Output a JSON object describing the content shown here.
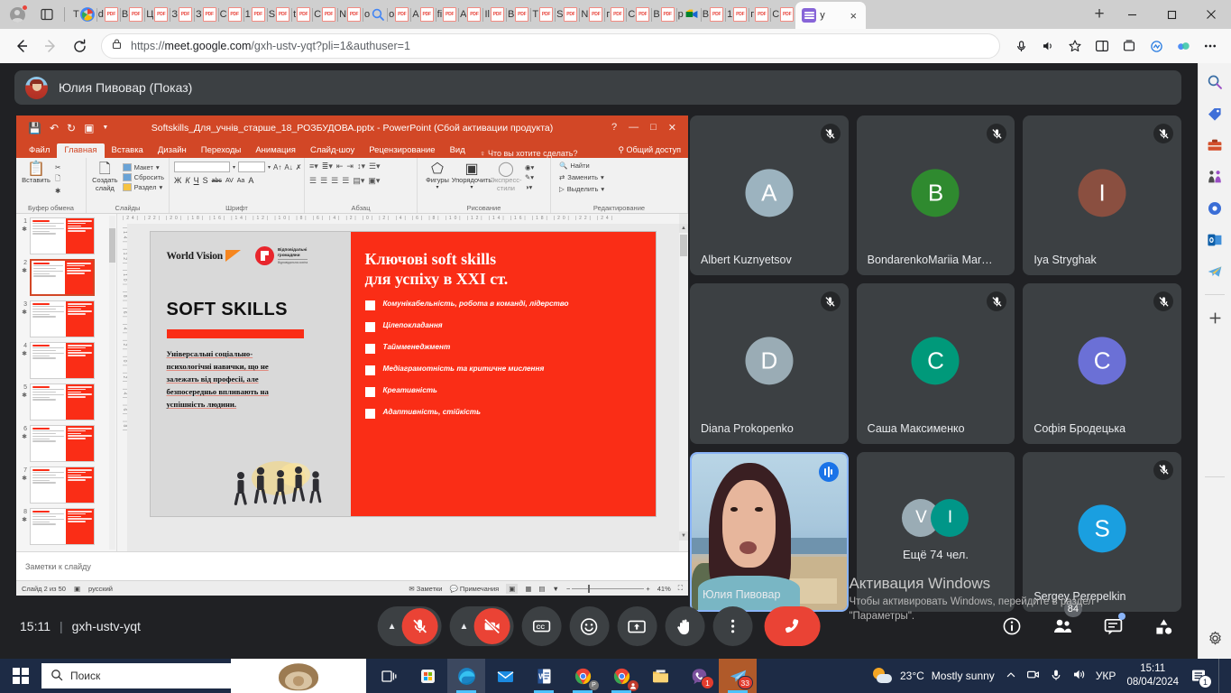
{
  "browser": {
    "name": "Microsoft Edge",
    "profile_icon": "profile-avatar-icon",
    "tab_search_icon": "tab-search-icon",
    "tabs": [
      {
        "title": "T",
        "icon": "google-icon"
      },
      {
        "title": "d",
        "icon": "pdf-icon"
      },
      {
        "title": "B",
        "icon": "pdf-icon"
      },
      {
        "title": "Ц",
        "icon": "pdf-icon"
      },
      {
        "title": "З",
        "icon": "pdf-icon"
      },
      {
        "title": "З",
        "icon": "pdf-icon"
      },
      {
        "title": "С",
        "icon": "pdf-icon"
      },
      {
        "title": "1",
        "icon": "pdf-icon"
      },
      {
        "title": "S",
        "icon": "pdf-icon"
      },
      {
        "title": "t",
        "icon": "pdf-icon"
      },
      {
        "title": "С",
        "icon": "pdf-icon"
      },
      {
        "title": "N",
        "icon": "pdf-icon"
      },
      {
        "title": "o",
        "icon": "search-icon"
      },
      {
        "title": "o",
        "icon": "pdf-icon"
      },
      {
        "title": "A",
        "icon": "pdf-icon"
      },
      {
        "title": "fi",
        "icon": "pdf-icon"
      },
      {
        "title": "A",
        "icon": "pdf-icon"
      },
      {
        "title": "Il",
        "icon": "pdf-icon"
      },
      {
        "title": "B",
        "icon": "pdf-icon"
      },
      {
        "title": "T",
        "icon": "pdf-icon"
      },
      {
        "title": "S",
        "icon": "pdf-icon"
      },
      {
        "title": "N",
        "icon": "pdf-icon"
      },
      {
        "title": "г",
        "icon": "pdf-icon"
      },
      {
        "title": "С",
        "icon": "pdf-icon"
      },
      {
        "title": "В",
        "icon": "pdf-icon"
      },
      {
        "title": "p",
        "icon": "meet-icon"
      },
      {
        "title": "В",
        "icon": "pdf-icon"
      },
      {
        "title": "1",
        "icon": "pdf-icon"
      },
      {
        "title": "г",
        "icon": "pdf-icon"
      },
      {
        "title": "С",
        "icon": "pdf-icon"
      }
    ],
    "active_tab": {
      "title": "у",
      "icon": "list-icon",
      "close_label": "×"
    },
    "new_tab_label": "+",
    "window_controls": {
      "minimize": "—",
      "maximize": "⬜",
      "close": "✕"
    },
    "toolbar": {
      "back_icon": "back-arrow-icon",
      "forward_icon": "forward-arrow-icon",
      "refresh_icon": "refresh-icon",
      "lock_icon": "lock-icon",
      "url_prefix": "https://",
      "url_domain": "meet.google.com",
      "url_path": "/gxh-ustv-yqt?pli=1&authuser=1",
      "mic_icon": "microphone-icon",
      "read_aloud_icon": "read-aloud-icon",
      "favorite_icon": "star-icon",
      "split_screen_icon": "split-screen-icon",
      "collections_icon": "collections-icon",
      "browser_essentials_icon": "browser-essentials-icon",
      "copilot_icon": "copilot-icon",
      "settings_more_icon": "more-options-icon"
    },
    "sidebar_icons": [
      "search-icon",
      "shopping-tag-icon",
      "tools-icon",
      "games-icon",
      "microsoft-365-icon",
      "outlook-icon",
      "telegram-icon",
      "add-sidebar-app-icon",
      "sidebar-settings-gear-icon"
    ]
  },
  "meet": {
    "presentation_header": {
      "presenter": "Юлия Пивовар (Показ)",
      "avatar_icon": "presenter-avatar"
    },
    "powerpoint": {
      "title": "Softskills_Для_учнів_старше_18_РОЗБУДОВА.pptx - PowerPoint (Сбой активации продукта)",
      "quick_access": [
        "save-icon",
        "undo-icon",
        "redo-icon",
        "present-icon",
        "customize-qat-icon"
      ],
      "window_controls": {
        "help": "?",
        "minimize": "—",
        "restore": "⬜",
        "close": "✕"
      },
      "ribbon_tabs": [
        "Файл",
        "Главная",
        "Вставка",
        "Дизайн",
        "Переходы",
        "Анимация",
        "Слайд-шоу",
        "Рецензирование",
        "Вид"
      ],
      "active_ribbon_tab": "Главная",
      "tell_me": "Что вы хотите сделать?",
      "share_label": "Общий доступ",
      "groups": [
        {
          "label": "Буфер обмена",
          "big_button": "Вставить",
          "items": [
            "Вырезать",
            "Копировать",
            "Формат по образцу"
          ]
        },
        {
          "label": "Слайды",
          "big_button": "Создать слайд",
          "items": [
            "Макет",
            "Сбросить",
            "Раздел"
          ]
        },
        {
          "label": "Шрифт",
          "items": [
            "Ж",
            "К",
            "Ч",
            "S",
            "abc",
            "AV",
            "Aa",
            "A"
          ]
        },
        {
          "label": "Абзац",
          "items": []
        },
        {
          "label": "Рисование",
          "items": [
            "Фигуры",
            "Упорядочить",
            "Экспресс-стили"
          ]
        },
        {
          "label": "Редактирование",
          "items": [
            "Найти",
            "Заменить",
            "Выделить"
          ]
        }
      ],
      "slide": {
        "logo_world_vision": "World Vision",
        "logo_responsible_1": "Відповідальні",
        "logo_responsible_2": "громадяни",
        "logo_responsible_sub": "Відповідальна освіта",
        "heading": "SOFT SKILLS",
        "body": "Універсальні соціально-психологічні навички, що не залежать від професії, але безпосередньо впливають на успішність людини.",
        "right_title_line1": "Ключові soft skills",
        "right_title_line2": "для успіху в XXI ст.",
        "bullets": [
          "Комунікабельність, робота в команді, лідерство",
          "Цілепокладання",
          "Таймменеджмент",
          "Медіаграмотність та критичне  мислення",
          "Креативність",
          "Адаптивність, стійкість"
        ],
        "accent_color": "#fa2d16"
      },
      "thumbnails": [
        "1",
        "2",
        "3",
        "4",
        "5",
        "6",
        "7",
        "8"
      ],
      "selected_thumbnail": "2",
      "notes_placeholder": "Заметки к слайду",
      "status": {
        "slide_counter": "Слайд 2 из 50",
        "language": "русский",
        "notes_btn": "Заметки",
        "comments_btn": "Примечания",
        "zoom": "41%",
        "view_icons": [
          "normal-view-icon",
          "slide-sorter-icon",
          "reading-view-icon",
          "slideshow-icon"
        ],
        "fit_icon": "fit-to-window-icon"
      }
    },
    "participants": [
      {
        "name": "Albert Kuznyetsov",
        "initial": "A",
        "color": "#9cb3bf",
        "muted": true,
        "type": "avatar"
      },
      {
        "name": "BondarenkoMariia Mar…",
        "initial": "B",
        "color": "#2f8a2f",
        "muted": true,
        "type": "avatar"
      },
      {
        "name": "Iya Stryghak",
        "initial": "I",
        "color": "#8a4f40",
        "muted": true,
        "type": "avatar"
      },
      {
        "name": "Diana Prokopenko",
        "initial": "D",
        "color": "#9aacb5",
        "muted": true,
        "type": "avatar"
      },
      {
        "name": "Саша Максименко",
        "initial": "C",
        "color": "#00997a",
        "muted": true,
        "type": "avatar"
      },
      {
        "name": "Софія Бродецька",
        "initial": "C",
        "color": "#6b70d6",
        "muted": true,
        "type": "avatar"
      },
      {
        "name": "Юлия Пивовар",
        "initial": "",
        "color": "",
        "muted": false,
        "type": "video",
        "speaking": true
      },
      {
        "name": "Ещё 74 чел.",
        "initial": "",
        "color": "",
        "muted": false,
        "type": "overflow",
        "overflow_avatars": [
          {
            "initial": "V",
            "color": "#9aacb5"
          },
          {
            "initial": "I",
            "color": "#009688"
          }
        ]
      },
      {
        "name": "Sergey Perepelkin",
        "initial": "S",
        "color": "#1a9fe0",
        "muted": true,
        "type": "avatar"
      }
    ],
    "bottom_bar": {
      "time": "15:11",
      "separator": "|",
      "meeting_code": "gxh-ustv-yqt",
      "controls": [
        {
          "name": "microphone-toggle",
          "state": "muted",
          "icon": "mic-off-icon"
        },
        {
          "name": "camera-toggle",
          "state": "off",
          "icon": "camera-off-icon"
        },
        {
          "name": "captions-toggle",
          "icon": "cc-icon"
        },
        {
          "name": "emoji-reactions",
          "icon": "emoji-icon"
        },
        {
          "name": "present-now",
          "icon": "present-screen-icon"
        },
        {
          "name": "raise-hand",
          "icon": "hand-icon"
        },
        {
          "name": "more-options",
          "icon": "more-vertical-icon"
        },
        {
          "name": "leave-call",
          "icon": "end-call-icon"
        }
      ],
      "right_controls": [
        {
          "name": "meeting-details",
          "icon": "info-icon"
        },
        {
          "name": "show-everyone",
          "icon": "people-icon",
          "badge": "84"
        },
        {
          "name": "chat-with-everyone",
          "icon": "chat-icon",
          "has_dot": true
        },
        {
          "name": "activities",
          "icon": "activities-icon"
        }
      ]
    },
    "windows_activation": {
      "title": "Активация Windows",
      "subtitle_line1": "Чтобы активировать Windows, перейдите в раздел",
      "subtitle_line2": "\"Параметры\"."
    }
  },
  "taskbar": {
    "start_icon": "windows-start-icon",
    "search_placeholder": "Поиск",
    "search_icon": "search-icon",
    "wallpaper_icon": "hedgehog-wallpaper",
    "apps": [
      {
        "name": "task-view",
        "icon": "task-view-icon",
        "badge": null
      },
      {
        "name": "microsoft-store",
        "icon": "store-icon",
        "badge": null
      },
      {
        "name": "microsoft-edge",
        "icon": "edge-icon",
        "badge": null,
        "active": true
      },
      {
        "name": "mail",
        "icon": "mail-icon",
        "badge": null
      },
      {
        "name": "word",
        "icon": "word-icon",
        "badge": null,
        "open": true
      },
      {
        "name": "chrome-profile-p",
        "icon": "chrome-icon",
        "badge": null,
        "open": true
      },
      {
        "name": "chrome-profile-2",
        "icon": "chrome-icon",
        "badge": null,
        "open": true
      },
      {
        "name": "file-explorer",
        "icon": "folder-icon",
        "badge": null
      },
      {
        "name": "viber",
        "icon": "viber-icon",
        "badge": "1"
      },
      {
        "name": "telegram",
        "icon": "telegram-icon",
        "badge": "33",
        "active": true
      }
    ],
    "tray": {
      "weather_temp": "23°C",
      "weather_desc": "Mostly sunny",
      "weather_icon": "sun-cloud-icon",
      "chevron_icon": "show-hidden-icons-icon",
      "icons": [
        "camera-icon",
        "microphone-icon",
        "volume-icon"
      ],
      "language": "УКР",
      "time": "15:11",
      "date": "08/04/2024",
      "notification_icon": "notifications-icon",
      "notification_count": "1"
    }
  }
}
